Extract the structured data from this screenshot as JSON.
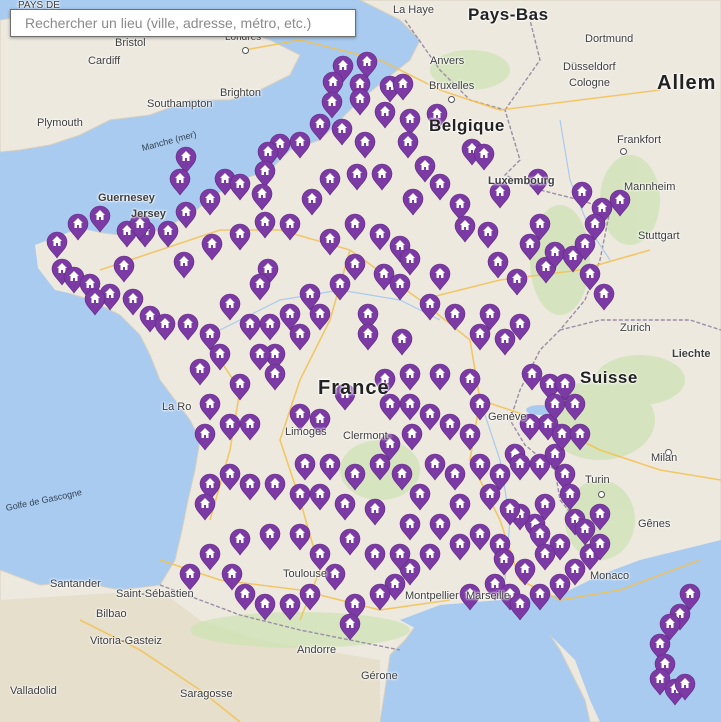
{
  "search": {
    "placeholder": "Rechercher un lieu (ville, adresse, métro, etc.)",
    "value": ""
  },
  "colors": {
    "sea": "#a9cbf0",
    "land": "#ede9df",
    "marker": "#7c3aa5",
    "border": "#9b8ea5"
  },
  "marker_icon": "home-pin-icon",
  "labels": {
    "pays_de": "PAYS DE",
    "la_haye": "La Haye",
    "pays_bas": "Pays-Bas",
    "dortmund": "Dortmund",
    "bristol": "Bristol",
    "cardiff": "Cardiff",
    "londres": "Londres",
    "anvers": "Anvers",
    "dusseldorf": "Düsseldorf",
    "cologne": "Cologne",
    "brighton": "Brighton",
    "southampton": "Southampton",
    "bruxelles": "Bruxelles",
    "allem": "Allem",
    "plymouth": "Plymouth",
    "belgique": "Belgique",
    "manche": "Manche (mer)",
    "frankfort": "Frankfort",
    "guernesey": "Guernesey",
    "jersey": "Jersey",
    "luxembourg": "Luxembourg",
    "mannheim": "Mannheim",
    "stuttgart": "Stuttgart",
    "zurich": "Zurich",
    "liechte": "Liechte",
    "suisse": "Suisse",
    "france": "France",
    "limoges": "Limoges",
    "clermont": "Clermont-",
    "geneve": "Genève",
    "milan": "Milan",
    "golfe": "Golfe de Gascogne",
    "turin": "Turin",
    "genes": "Gênes",
    "toulouse": "Toulouse",
    "santander": "Santander",
    "saint_sebastien": "Saint-Sébastien",
    "bilbao": "Bilbao",
    "vitoria": "Vitoria-Gasteiz",
    "andorre": "Andorre",
    "montpellier": "Montpellier",
    "marseille": "Marseille",
    "monaco": "Monaco",
    "gerone": "Gérone",
    "valladolid": "Valladolid",
    "saragosse": "Saragosse",
    "la_ro": "La Ro"
  }
}
